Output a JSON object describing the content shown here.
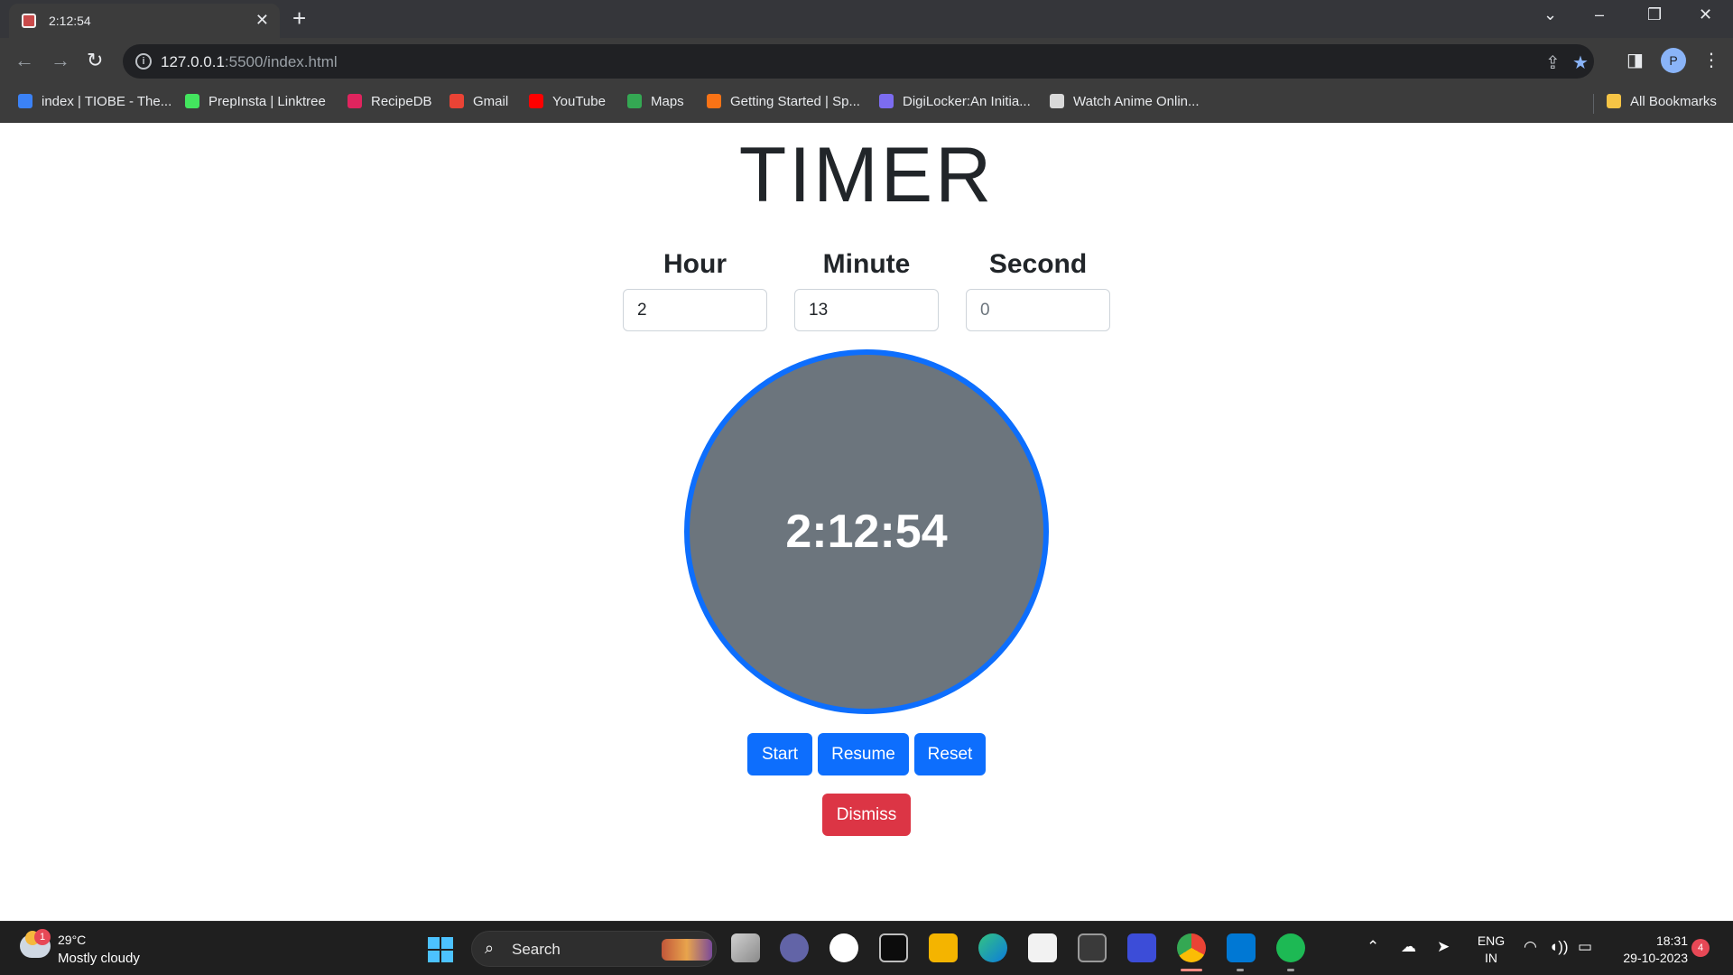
{
  "browser": {
    "tab_title": "2:12:54",
    "url_host": "127.0.0.1",
    "url_path": ":5500/index.html",
    "bookmarks": [
      {
        "label": "index | TIOBE - The...",
        "color": "#3b82f6"
      },
      {
        "label": "PrepInsta | Linktree",
        "color": "#43e55e"
      },
      {
        "label": "RecipeDB",
        "color": "#e0245e"
      },
      {
        "label": "Gmail",
        "color": "#ea4335"
      },
      {
        "label": "YouTube",
        "color": "#ff0000"
      },
      {
        "label": "Maps",
        "color": "#34a853"
      },
      {
        "label": "Getting Started | Sp...",
        "color": "#f97316"
      },
      {
        "label": "DigiLocker:An Initia...",
        "color": "#7c6cf0"
      },
      {
        "label": "Watch Anime Onlin...",
        "color": "#d9d9d9"
      }
    ],
    "all_bookmarks_label": "All Bookmarks",
    "profile_initial": "P"
  },
  "page": {
    "title": "TIMER",
    "fields": [
      {
        "label": "Hour",
        "value": "2",
        "placeholder": ""
      },
      {
        "label": "Minute",
        "value": "13",
        "placeholder": ""
      },
      {
        "label": "Second",
        "value": "",
        "placeholder": "0"
      }
    ],
    "display": "2:12:54",
    "buttons": {
      "start": "Start",
      "resume": "Resume",
      "reset": "Reset",
      "dismiss": "Dismiss"
    },
    "colors": {
      "primary": "#0d6efd",
      "danger": "#dc3545",
      "circle_fill": "#6c757d"
    }
  },
  "taskbar": {
    "weather_temp": "29°C",
    "weather_desc": "Mostly cloudy",
    "weather_badge": "1",
    "search_label": "Search",
    "lang_top": "ENG",
    "lang_bottom": "IN",
    "time": "18:31",
    "date": "29-10-2023",
    "notification_count": "4"
  }
}
